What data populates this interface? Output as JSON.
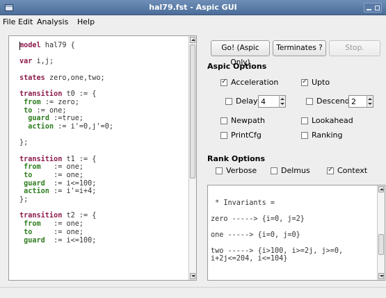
{
  "window": {
    "title": "hal79.fst - Aspic GUI"
  },
  "menu": [
    "File",
    "Edit",
    "Analysis",
    "Help"
  ],
  "editor": {
    "lines": [
      [
        {
          "t": "model",
          "c": "kw"
        },
        {
          "t": " hal79 {"
        }
      ],
      [
        {
          "t": ""
        }
      ],
      [
        {
          "t": "var",
          "c": "kw"
        },
        {
          "t": " i,j;"
        }
      ],
      [
        {
          "t": ""
        }
      ],
      [
        {
          "t": "states",
          "c": "kw"
        },
        {
          "t": " zero,one,two;"
        }
      ],
      [
        {
          "t": ""
        }
      ],
      [
        {
          "t": "transition",
          "c": "kw"
        },
        {
          "t": " t0 := {"
        }
      ],
      [
        {
          "t": " "
        },
        {
          "t": "from",
          "c": "kg"
        },
        {
          "t": " := zero;"
        }
      ],
      [
        {
          "t": " "
        },
        {
          "t": "to",
          "c": "kg"
        },
        {
          "t": " := one;"
        }
      ],
      [
        {
          "t": "  "
        },
        {
          "t": "guard",
          "c": "kg"
        },
        {
          "t": " :=true;"
        }
      ],
      [
        {
          "t": "  "
        },
        {
          "t": "action",
          "c": "kg"
        },
        {
          "t": " := i'=0,j'=0;"
        }
      ],
      [
        {
          "t": ""
        }
      ],
      [
        {
          "t": "};"
        }
      ],
      [
        {
          "t": ""
        }
      ],
      [
        {
          "t": "transition",
          "c": "kw"
        },
        {
          "t": " t1 := {"
        }
      ],
      [
        {
          "t": " "
        },
        {
          "t": "from",
          "c": "kg"
        },
        {
          "t": "   := one;"
        }
      ],
      [
        {
          "t": " "
        },
        {
          "t": "to",
          "c": "kg"
        },
        {
          "t": "     := one;"
        }
      ],
      [
        {
          "t": " "
        },
        {
          "t": "guard",
          "c": "kg"
        },
        {
          "t": "  := i<=100;"
        }
      ],
      [
        {
          "t": " "
        },
        {
          "t": "action",
          "c": "kg"
        },
        {
          "t": " := i'=i+4;"
        }
      ],
      [
        {
          "t": "};"
        }
      ],
      [
        {
          "t": ""
        }
      ],
      [
        {
          "t": "transition",
          "c": "kw"
        },
        {
          "t": " t2 := {"
        }
      ],
      [
        {
          "t": " "
        },
        {
          "t": "from",
          "c": "kg"
        },
        {
          "t": "   := one;"
        }
      ],
      [
        {
          "t": " "
        },
        {
          "t": "to",
          "c": "kg"
        },
        {
          "t": "     := one;"
        }
      ],
      [
        {
          "t": " "
        },
        {
          "t": "guard",
          "c": "kg"
        },
        {
          "t": "  := i<=100;"
        }
      ]
    ]
  },
  "buttons": {
    "go": "Go! (Aspic Only)",
    "terminates": "Terminates ?",
    "stop": "Stop."
  },
  "aspic_options": {
    "title": "Aspic Options",
    "acceleration": {
      "label": "Acceleration",
      "checked": true
    },
    "upto": {
      "label": "Upto",
      "checked": true
    },
    "delay": {
      "label": "Delay",
      "checked": false,
      "value": "4"
    },
    "descend": {
      "label": "Descend",
      "checked": false,
      "value": "2"
    },
    "newpath": {
      "label": "Newpath",
      "checked": false
    },
    "lookahead": {
      "label": "Lookahead",
      "checked": false
    },
    "printcfg": {
      "label": "PrintCfg",
      "checked": false
    },
    "ranking": {
      "label": "Ranking",
      "checked": false
    }
  },
  "rank_options": {
    "title": "Rank Options",
    "verbose": {
      "label": "Verbose",
      "checked": false
    },
    "delmus": {
      "label": "Delmus",
      "checked": false
    },
    "context": {
      "label": "Context",
      "checked": true
    }
  },
  "output": {
    "lines": [
      "",
      " * Invariants =",
      "",
      "zero -----> {i=0, j=2}",
      "",
      "one -----> {i=0, j=0}",
      "",
      "two -----> {i>100, i>=2j, j>=0,",
      "i+2j<=204, i<=104}"
    ]
  }
}
